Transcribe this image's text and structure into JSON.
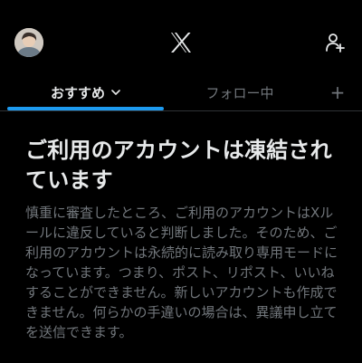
{
  "header": {
    "avatar_icon": "user-avatar",
    "logo_icon": "x-logo",
    "add_user_icon": "add-person-icon"
  },
  "tabs": [
    {
      "label": "おすすめ",
      "active": true,
      "has_dropdown": true
    },
    {
      "label": "フォロー中",
      "active": false
    }
  ],
  "tab_add_label": "+",
  "notice": {
    "title": "ご利用のアカウントは凍結されています",
    "body": "慎重に審査したところ、ご利用のアカウントはXルールに違反していると判断しました。そのため、ご利用のアカウントは永続的に読み取り専用モードになっています。つまり、ポスト、リポスト、いいねすることができません。新しいアカウントも作成できません。何らかの手違いの場合は、異議申し立てを送信できます。"
  },
  "colors": {
    "background": "#000000",
    "text_primary": "#e7e9ea",
    "text_secondary": "#71767b",
    "accent": "#1d9bf0",
    "divider": "#2f3336"
  }
}
